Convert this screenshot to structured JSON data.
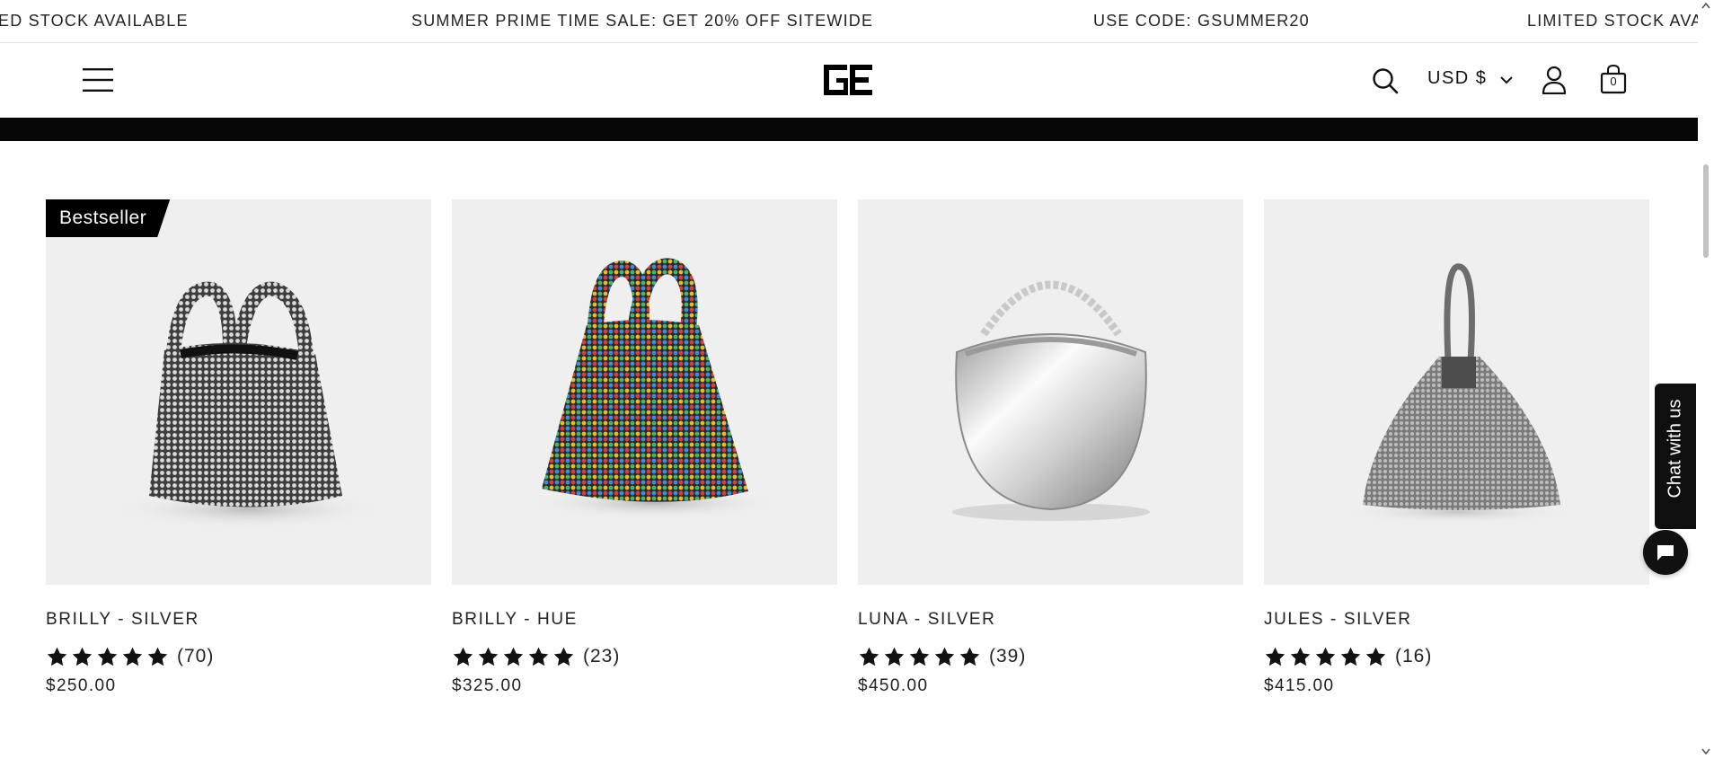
{
  "announcement": {
    "items": [
      "ED STOCK AVAILABLE",
      "SUMMER PRIME TIME SALE: GET 20% OFF SITEWIDE",
      "USE CODE: GSUMMER20",
      "LIMITED STOCK AVA"
    ]
  },
  "header": {
    "currency": "USD $",
    "cart_count": "0",
    "icons": [
      "menu-icon",
      "brand-logo",
      "search-icon",
      "chevron-down-icon",
      "account-icon",
      "cart-icon"
    ]
  },
  "products": [
    {
      "badge": "Bestseller",
      "name": "BRILLY - SILVER",
      "rating": 5,
      "reviews": "(70)",
      "price": "$250.00"
    },
    {
      "badge": "",
      "name": "BRILLY - HUE",
      "rating": 5,
      "reviews": "(23)",
      "price": "$325.00"
    },
    {
      "badge": "",
      "name": "LUNA - SILVER",
      "rating": 5,
      "reviews": "(39)",
      "price": "$450.00"
    },
    {
      "badge": "",
      "name": "JULES - SILVER",
      "rating": 5,
      "reviews": "(16)",
      "price": "$415.00"
    }
  ],
  "chat": {
    "label": "Chat with us"
  },
  "colors": {
    "text": "#111111",
    "image_bg": "#efefef",
    "badge_bg": "#000000",
    "chat_bg": "#0f0f0f"
  }
}
